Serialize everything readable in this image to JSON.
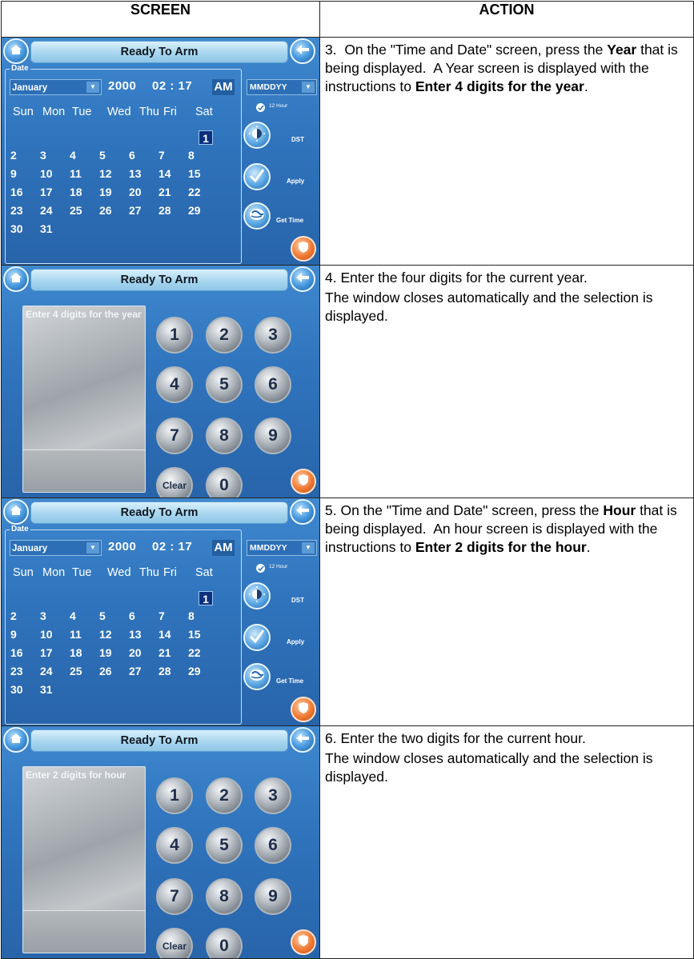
{
  "headers": {
    "screen": "SCREEN",
    "action": "ACTION"
  },
  "ui": {
    "title": "Ready To Arm",
    "date_legend": "Date",
    "month": "January",
    "year": "2000",
    "time": "02 : 17",
    "ampm": "AM",
    "format": "MMDDYY",
    "hour12": "12 Hour",
    "dst": "DST",
    "apply": "Apply",
    "get_time": "Get Time",
    "dows": [
      "Sun",
      "Mon",
      "Tue",
      "Wed",
      "Thu",
      "Fri",
      "Sat"
    ],
    "weeks": [
      [
        "",
        "",
        "",
        "",
        "",
        "",
        "1"
      ],
      [
        "2",
        "3",
        "4",
        "5",
        "6",
        "7",
        "8"
      ],
      [
        "9",
        "10",
        "11",
        "12",
        "13",
        "14",
        "15"
      ],
      [
        "16",
        "17",
        "18",
        "19",
        "20",
        "21",
        "22"
      ],
      [
        "23",
        "24",
        "25",
        "26",
        "27",
        "28",
        "29"
      ],
      [
        "30",
        "31",
        "",
        "",
        "",
        "",
        ""
      ]
    ],
    "keys": [
      "1",
      "2",
      "3",
      "4",
      "5",
      "6",
      "7",
      "8",
      "9",
      "Clear",
      "0"
    ]
  },
  "rows": [
    {
      "prompt": "",
      "action_html": "3.&nbsp; On the \"Time and Date\" screen, press the <b>Year</b> that is being displayed.&nbsp; A Year screen is displayed with the instructions to <b>Enter 4 digits for the year</b>."
    },
    {
      "prompt": "Enter 4 digits for the year",
      "action1": "4.  Enter the four digits for the current year.",
      "action2": "The window closes automatically and the selection is displayed."
    },
    {
      "prompt": "",
      "action_html": "5. On the \"Time and Date\" screen, press the <b>Hour</b> that is being displayed.&nbsp; An hour screen is displayed with the instructions to <b>Enter 2 digits for the hour</b>."
    },
    {
      "prompt": "Enter 2 digits for hour",
      "action1": "6. Enter the two digits for the current hour.",
      "action2": "The window closes automatically and the selection is displayed."
    }
  ]
}
